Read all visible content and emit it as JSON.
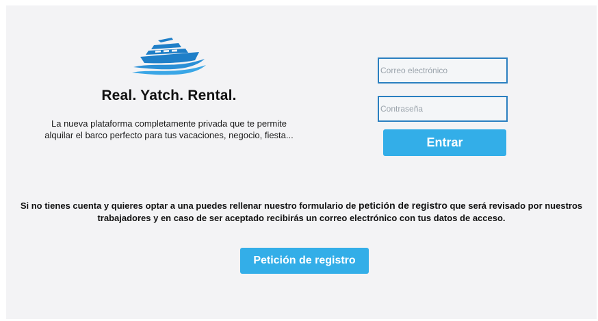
{
  "brand": {
    "logo_icon": "yacht-logo-icon",
    "title": "Real. Yatch. Rental.",
    "tagline": "La nueva plataforma completamente privada que te permite alquilar el barco perfecto para tus vacaciones, negocio, fiesta..."
  },
  "login": {
    "email_placeholder": "Correo electrónico",
    "email_value": "",
    "password_placeholder": "Contraseña",
    "password_value": "",
    "submit_label": "Entrar"
  },
  "register": {
    "info_before": "Si no tienes cuenta y quieres optar a una puedes rellenar nuestro formulario de ",
    "info_emphasis": "petición de registro",
    "info_after": " que será revisado por nuestros trabajadores y en caso de ser aceptado recibirás un correo electrónico con tus datos de acceso.",
    "button_label": "Petición de registro"
  },
  "colors": {
    "accent": "#33aee8",
    "field_border": "#2a7fc0",
    "panel_bg": "#f3f3f5",
    "logo_blue": "#1f7fc8"
  }
}
